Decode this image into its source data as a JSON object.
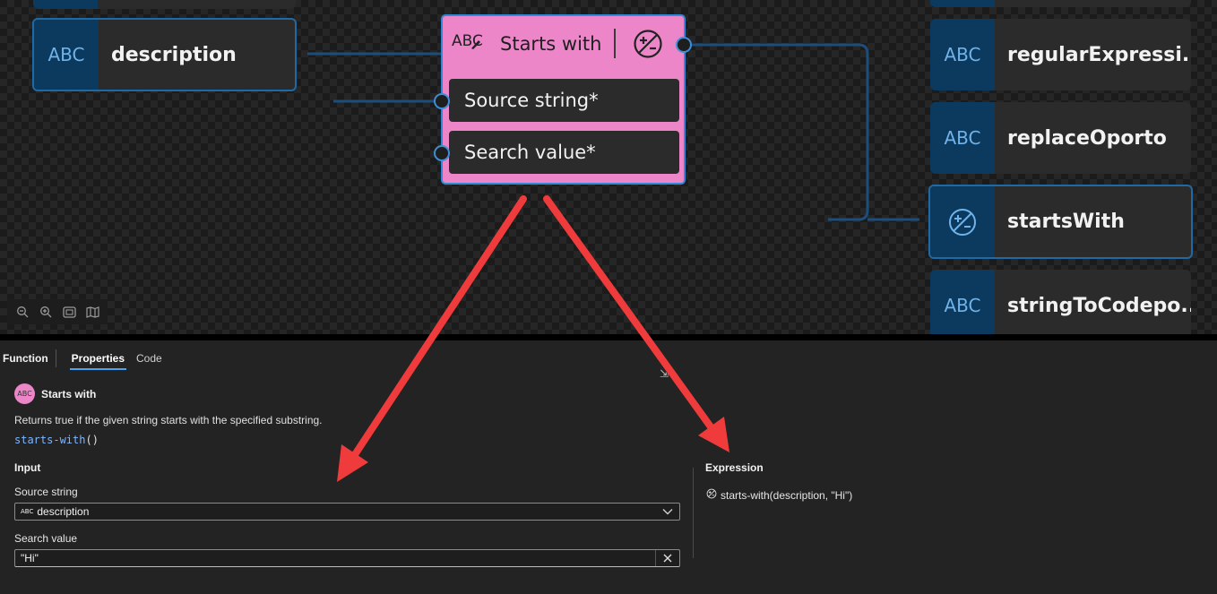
{
  "canvas": {
    "left_nodes": [
      {
        "icon": "ABC",
        "label": "description"
      }
    ],
    "function_node": {
      "icon": "ABC",
      "title": "Starts with",
      "inputs": [
        "Source string*",
        "Search value*"
      ]
    },
    "right_nodes": [
      {
        "icon": "ABC",
        "label": "regularExpressi..."
      },
      {
        "icon": "ABC",
        "label": "replaceOporto"
      },
      {
        "icon": "bool-icon",
        "label": "startsWith"
      },
      {
        "icon": "ABC",
        "label": "stringToCodepo..."
      }
    ],
    "zoom_controls": [
      "zoom-out-icon",
      "zoom-in-icon",
      "fit-view-icon",
      "minimap-icon"
    ]
  },
  "panel": {
    "header": "Function",
    "tabs": [
      "Properties",
      "Code"
    ],
    "active_tab": "Properties",
    "function": {
      "icon_text": "ABC",
      "name": "Starts with",
      "description": "Returns true if the given string starts with the specified substring.",
      "code_name": "starts-with",
      "code_parens": "()"
    },
    "input": {
      "title": "Input",
      "source_label": "Source string",
      "source_icon": "ABC",
      "source_value": "description",
      "search_label": "Search value",
      "search_value": "\"Hi\""
    },
    "expression": {
      "title": "Expression",
      "value": "starts-with(description, \"Hi\")"
    }
  },
  "colors": {
    "accent": "#2f89d6",
    "function_node": "#ec86c8",
    "annotation_arrow": "#ef3b3b",
    "node_icon_bg": "#0c3a5e"
  }
}
